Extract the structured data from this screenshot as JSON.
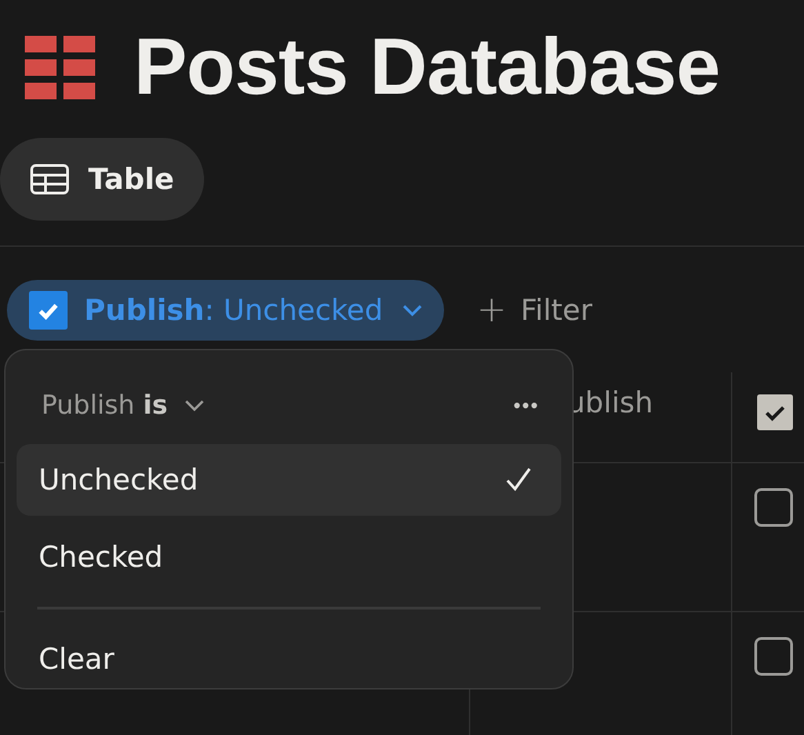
{
  "page": {
    "title": "Posts Database"
  },
  "views": [
    {
      "label": "Table",
      "selected": true
    }
  ],
  "filter_chip": {
    "label": "**Publish**: Unchecked",
    "checked": true
  },
  "add_filter": {
    "icon": "+",
    "label": "Filter"
  },
  "table": {
    "columns": [
      "ublish"
    ],
    "rows": [
      {
        "checked": false
      },
      {
        "checked": false
      }
    ]
  },
  "dropdown": {
    "header": "Publish **is**",
    "more": "•••",
    "options": [
      {
        "label": "Unchecked",
        "selected": true
      },
      {
        "label": "Checked",
        "selected": false
      }
    ],
    "clear": "Clear"
  }
}
